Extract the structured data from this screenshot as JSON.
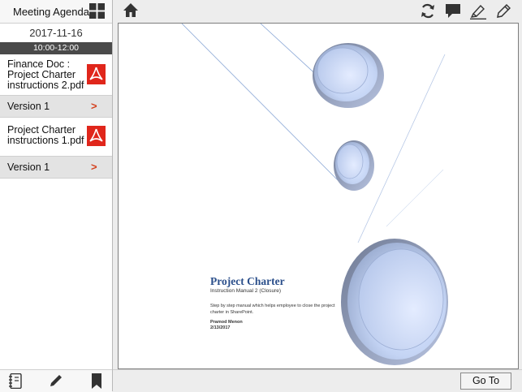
{
  "sidebar": {
    "title": "Meeting Agenda",
    "date": "2017-11-16",
    "time_range": "10:00-12:00",
    "documents": [
      {
        "name": "Finance Doc : Project Charter instructions 2.pdf",
        "version_label": "Version 1",
        "arrow": ">"
      },
      {
        "name": "Project Charter instructions 1.pdf",
        "version_label": "Version 1",
        "arrow": ">"
      }
    ]
  },
  "footer": {
    "goto_label": "Go To"
  },
  "document_page": {
    "title": "Project Charter",
    "subtitle": "Instruction Manual 2 (Closure)",
    "description": "Step by step manual which helps employee to close the project charter in SharePoint.",
    "author": "Pramod Menon",
    "date": "2/13/2017"
  },
  "icons": {
    "grid": "grid-view-icon",
    "home": "home-icon",
    "sync": "sync-icon",
    "comment": "comment-icon",
    "highlighter": "highlighter-icon",
    "pencil": "pencil-icon",
    "notebook": "notebook-icon",
    "edit": "edit-icon",
    "bookmark": "bookmark-icon",
    "pdf": "pdf-icon"
  },
  "colors": {
    "accent_red": "#d4411e",
    "pdf_red": "#e0261b",
    "title_blue": "#2b4f8b",
    "time_bar": "#4a4a4a"
  }
}
